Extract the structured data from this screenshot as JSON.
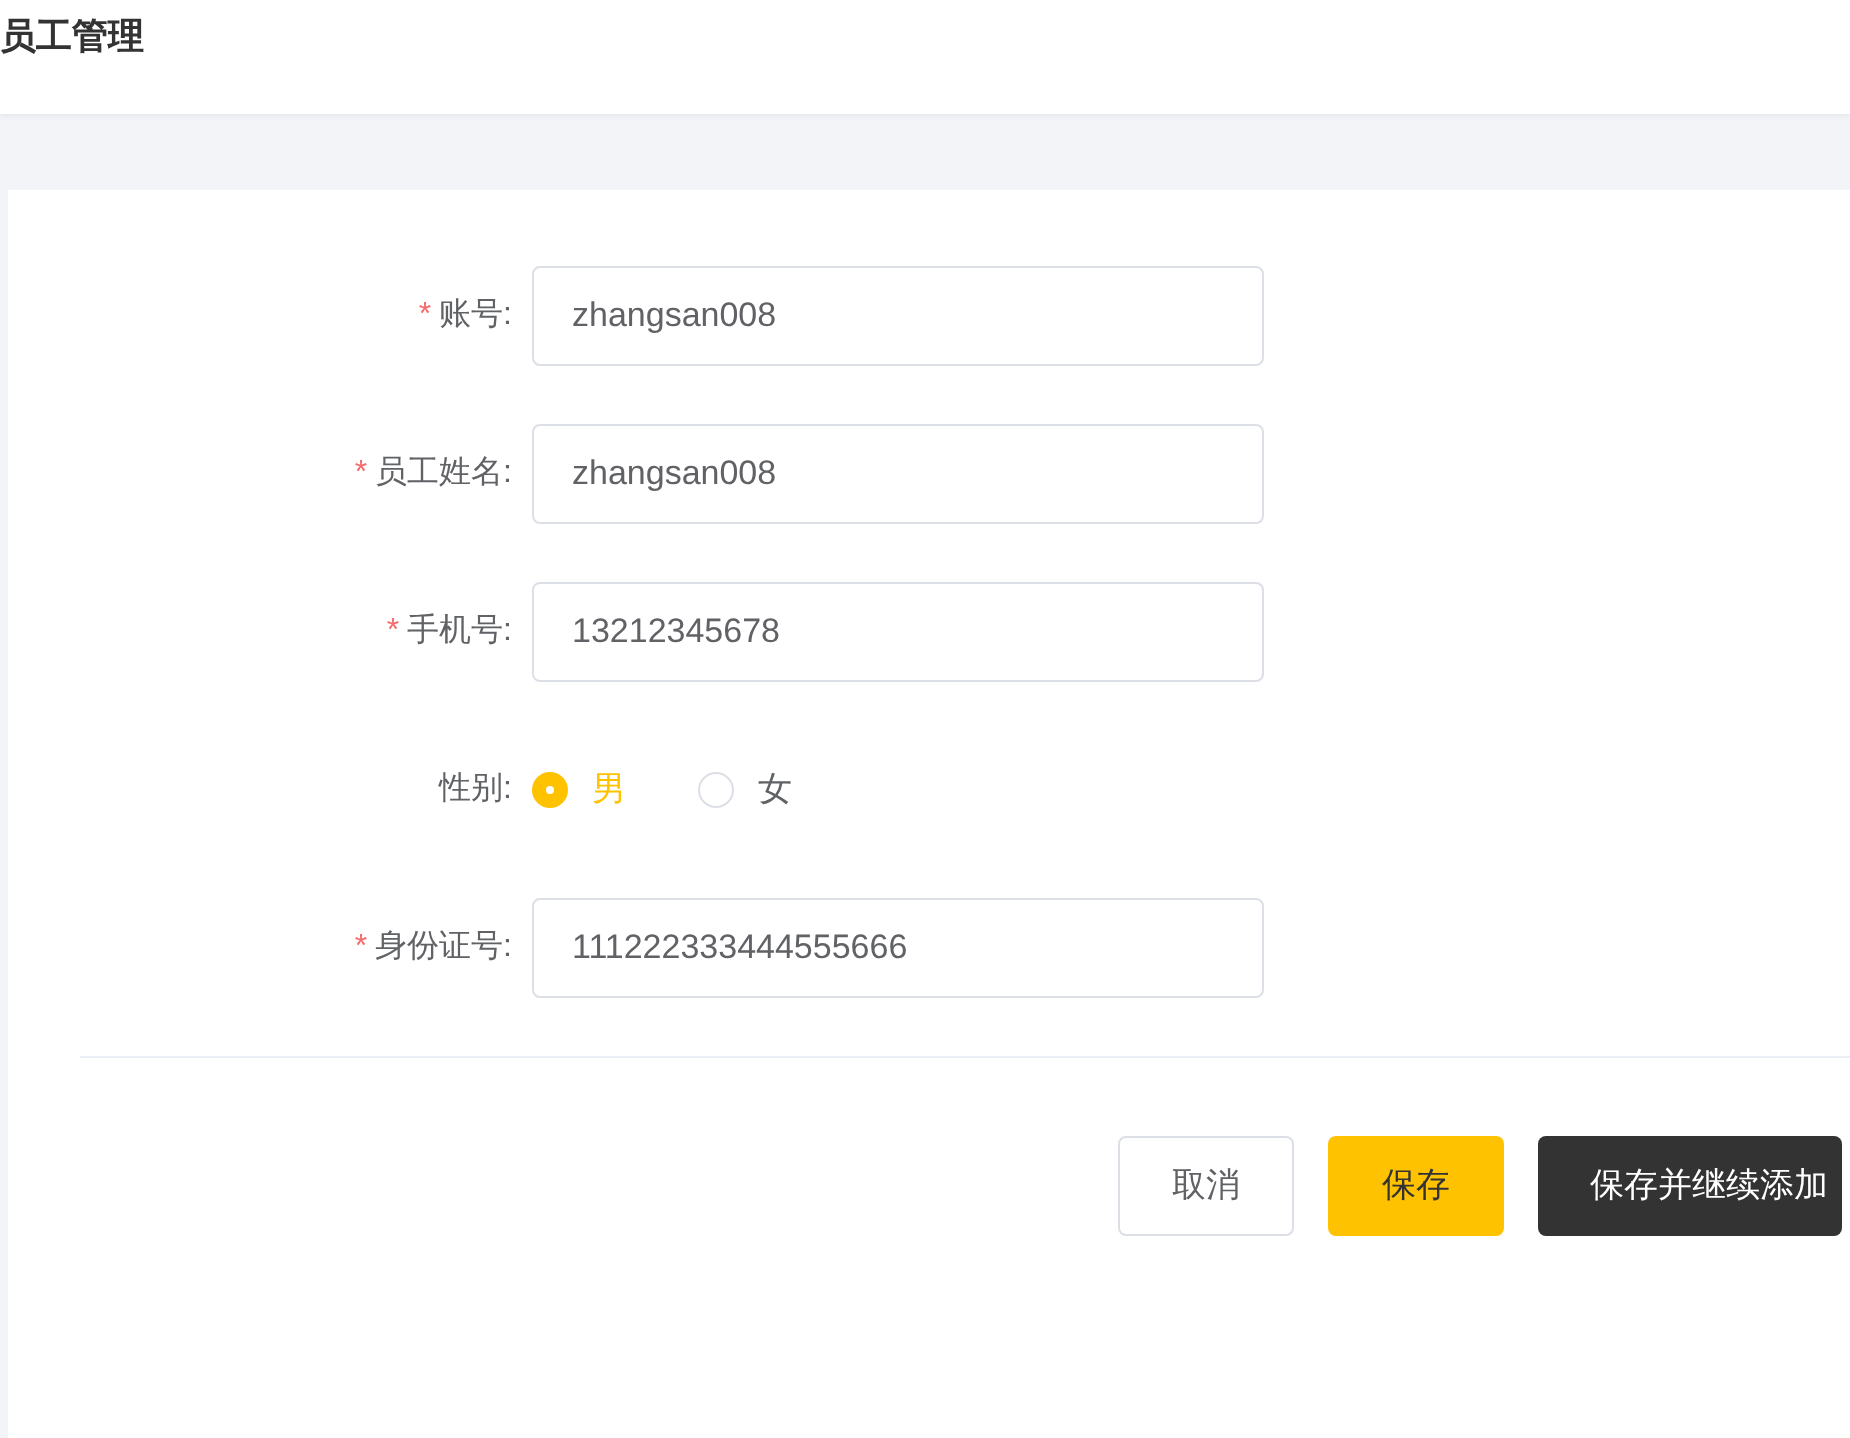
{
  "header": {
    "title": "员工管理"
  },
  "form": {
    "fields": [
      {
        "kind": "input",
        "label": "账号:",
        "required": true,
        "value": "zhangsan008"
      },
      {
        "kind": "input",
        "label": "员工姓名:",
        "required": true,
        "value": "zhangsan008"
      },
      {
        "kind": "input",
        "label": "手机号:",
        "required": true,
        "value": "13212345678"
      },
      {
        "kind": "radio",
        "label": "性别:",
        "required": false,
        "options": [
          {
            "label": "男",
            "selected": true
          },
          {
            "label": "女",
            "selected": false
          }
        ]
      },
      {
        "kind": "input",
        "label": "身份证号:",
        "required": true,
        "value": "111222333444555666"
      }
    ],
    "required_mark": "*",
    "buttons": [
      {
        "kind": "cancel",
        "label": "取消"
      },
      {
        "kind": "primary",
        "label": "保存"
      },
      {
        "kind": "dark",
        "label": "保存并继续添加"
      }
    ]
  }
}
